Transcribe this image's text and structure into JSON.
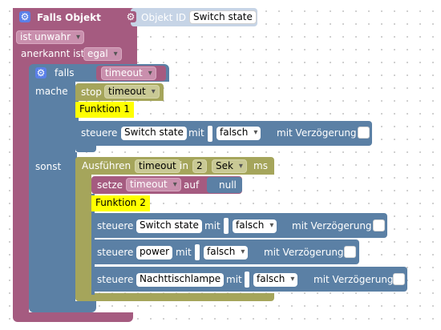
{
  "colors": {
    "event": "#a55b80",
    "logic": "#5b80a5",
    "timer": "#a5a55b",
    "device": "#5b80a5",
    "function": "#ffff00",
    "value_field": "#ffffff"
  },
  "falls_objekt": {
    "title": "Falls Objekt",
    "objekt_id_label": "Objekt ID",
    "objekt_id_value": "Switch state",
    "condition": "ist unwahr",
    "ack_label": "anerkannt ist",
    "ack_value": "egal"
  },
  "if_block": {
    "falls_label": "falls",
    "condition_var": "timeout",
    "mache_label": "mache",
    "sonst_label": "sonst"
  },
  "mache": {
    "stop_label": "stop",
    "stop_var": "timeout",
    "function_1": "Funktion 1",
    "control": {
      "label": "steuere",
      "target": "Switch state",
      "mit": "mit",
      "value": "falsch",
      "delay_label": "mit Verzögerung"
    }
  },
  "sonst": {
    "timeout_label": "Ausführen",
    "timeout_var": "timeout",
    "in_label": "in",
    "in_value": "2",
    "unit": "Sek",
    "ms_label": "ms",
    "set_label": "setze",
    "set_var": "timeout",
    "auf_label": "auf",
    "auf_value": "null",
    "function_2": "Funktion 2",
    "controls": [
      {
        "label": "steuere",
        "target": "Switch state",
        "mit": "mit",
        "value": "falsch",
        "delay_label": "mit Verzögerung"
      },
      {
        "label": "steuere",
        "target": "power",
        "mit": "mit",
        "value": "falsch",
        "delay_label": "mit Verzögerung"
      },
      {
        "label": "steuere",
        "target": "Nachttischlampe",
        "mit": "mit",
        "value": "falsch",
        "delay_label": "mit Verzögerung"
      }
    ]
  }
}
